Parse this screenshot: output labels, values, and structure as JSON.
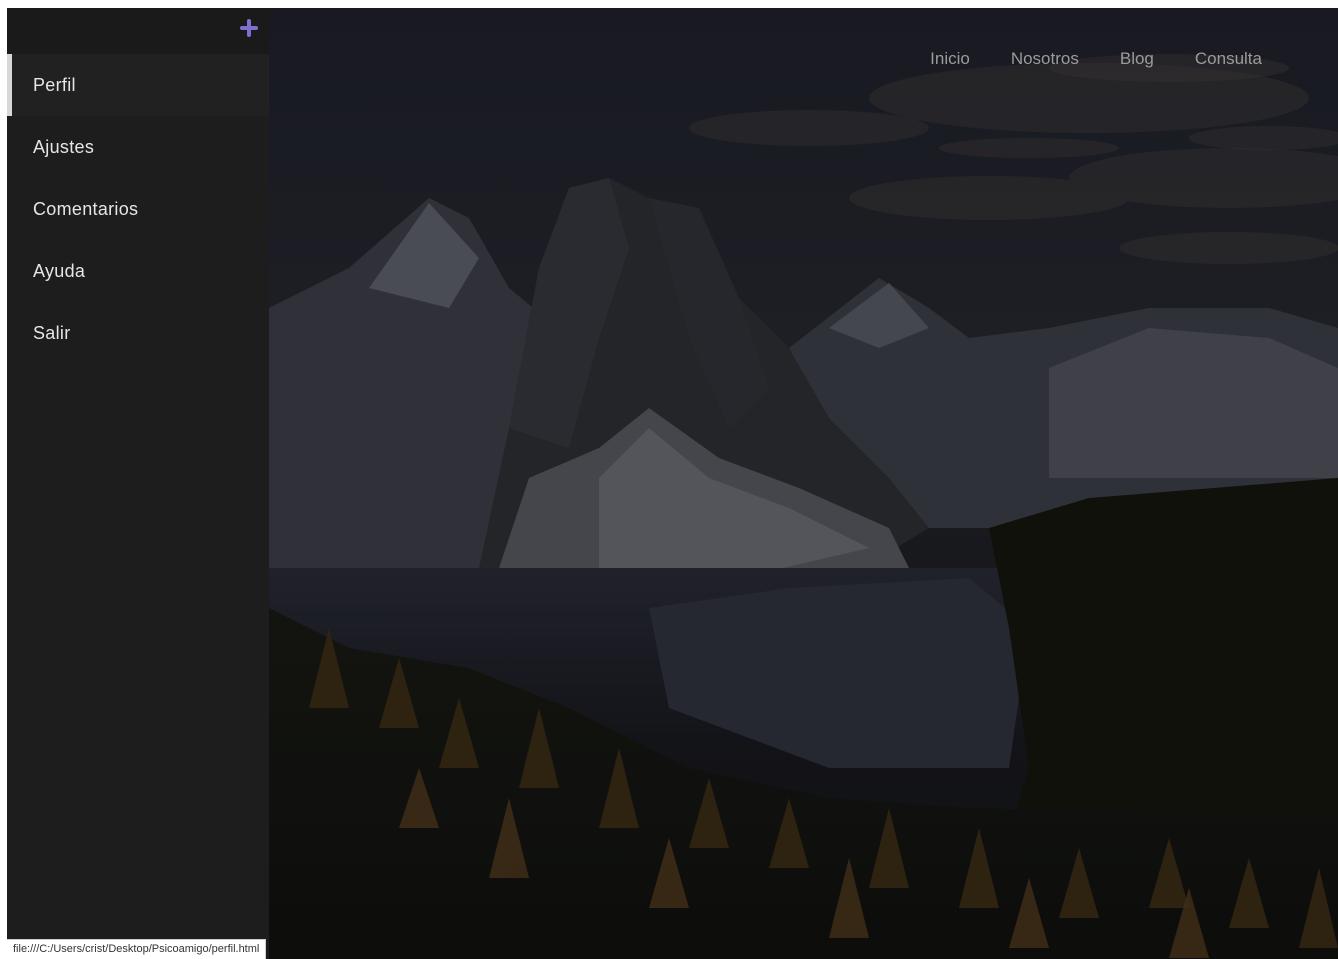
{
  "sidebar": {
    "add_icon": "plus-icon",
    "accent_color": "#7e6fd0",
    "items": [
      {
        "label": "Perfil",
        "active": true
      },
      {
        "label": "Ajustes"
      },
      {
        "label": "Comentarios"
      },
      {
        "label": "Ayuda"
      },
      {
        "label": "Salir"
      }
    ]
  },
  "nav": {
    "links": [
      "Inicio",
      "Nosotros",
      "Blog",
      "Consulta"
    ]
  },
  "status": {
    "url": "file:///C:/Users/crist/Desktop/Psicoamigo/perfil.html"
  }
}
